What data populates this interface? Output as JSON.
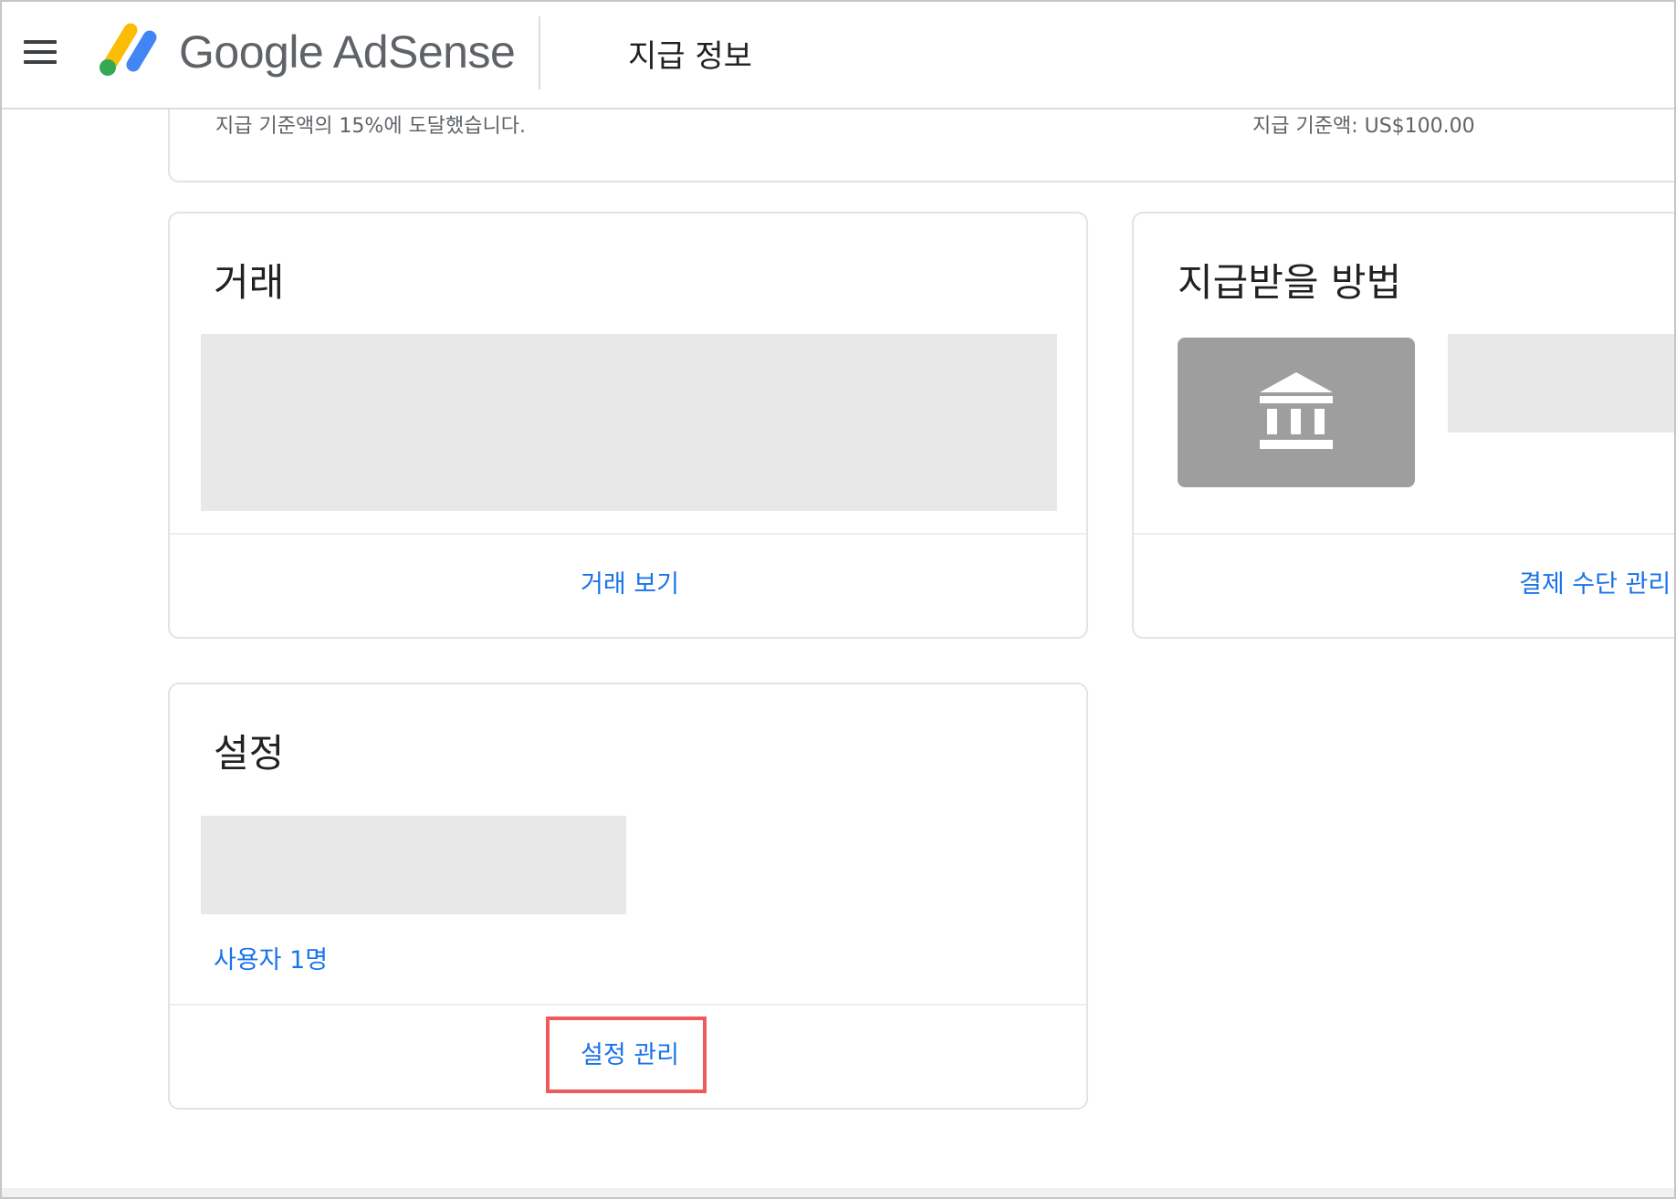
{
  "header": {
    "brand": "Google AdSense",
    "page_title": "지급 정보"
  },
  "summary": {
    "progress_text": "지급 기준액의 15%에 도달했습니다.",
    "threshold_text": "지급 기준액: US$100.00"
  },
  "transactions_card": {
    "title": "거래",
    "link": "거래 보기"
  },
  "payment_method_card": {
    "title": "지급받을 방법",
    "icon": "bank-icon",
    "link": "결제 수단 관리"
  },
  "settings_card": {
    "title": "설정",
    "users_link": "사용자 1명",
    "manage_link": "설정 관리"
  },
  "colors": {
    "link": "#1a73e8",
    "highlight": "#ef5b5b",
    "placeholder": "#e8e8e8",
    "bank_tile": "#9e9e9e"
  }
}
